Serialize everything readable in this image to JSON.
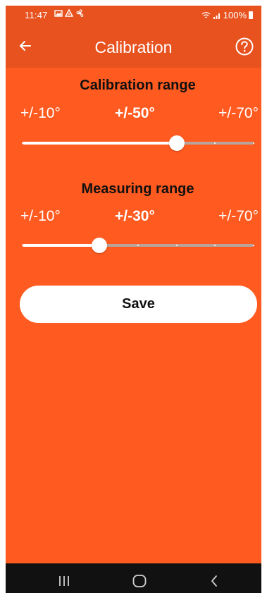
{
  "status_bar": {
    "time": "11:47",
    "battery": "100%",
    "left_icons": [
      "gallery-icon",
      "notification-icon",
      "fan-icon"
    ],
    "right_icons": [
      "wifi-icon",
      "signal-icon",
      "battery-icon"
    ]
  },
  "app_bar": {
    "title": "Calibration",
    "back_icon": "arrow-left-icon",
    "help_icon": "help-circle-icon"
  },
  "calibration": {
    "title": "Calibration range",
    "min_label": "+/-10°",
    "value_label": "+/-50°",
    "max_label": "+/-70°",
    "min": 10,
    "max": 70,
    "step": 10,
    "value": 50
  },
  "measuring": {
    "title": "Measuring range",
    "min_label": "+/-10°",
    "value_label": "+/-30°",
    "max_label": "+/-70°",
    "min": 10,
    "max": 70,
    "step": 10,
    "value": 30
  },
  "save_label": "Save",
  "nav_bar": {
    "buttons": [
      "recent-apps-icon",
      "home-icon",
      "back-icon"
    ]
  },
  "colors": {
    "background": "#FF5A1F",
    "app_bar": "#E8521F",
    "track_inactive": "#B8A49B",
    "nav_bar": "#111111"
  }
}
